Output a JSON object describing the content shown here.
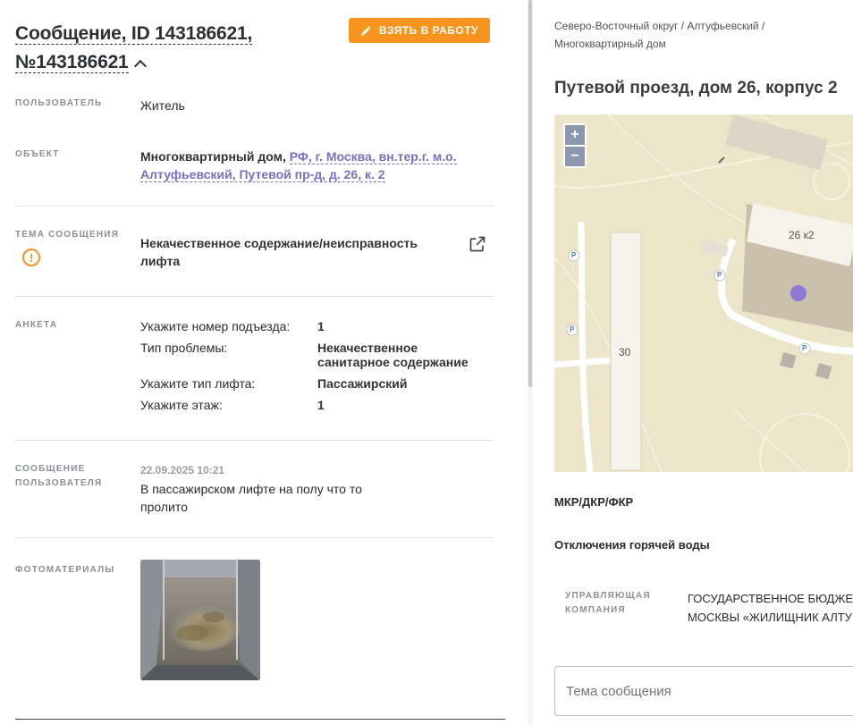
{
  "header": {
    "title_line1": "Сообщение, ID 143186621,",
    "title_line2": "№143186621",
    "take_button": "ВЗЯТЬ В РАБОТУ"
  },
  "user": {
    "label": "ПОЛЬЗОВАТЕЛЬ",
    "value": "Житель"
  },
  "object": {
    "label": "ОБЪЕКТ",
    "type": "Многоквартирный дом,",
    "address_link_line1": "РФ, г. Москва, вн.тер.г. м.о.",
    "address_link_line2": "Алтуфьевский, Путевой пр-д, д. 26, к. 2"
  },
  "topic": {
    "label": "ТЕМА СООБЩЕНИЯ",
    "value": "Некачественное содержание/неисправность лифта",
    "warn_glyph": "!"
  },
  "survey": {
    "label": "АНКЕТА",
    "rows": [
      {
        "q": "Укажите номер подъезда:",
        "a": "1"
      },
      {
        "q": "Тип проблемы:",
        "a": "Некачественное санитарное содержание"
      },
      {
        "q": "Укажите тип лифта:",
        "a": "Пассажирский"
      },
      {
        "q": "Укажите этаж:",
        "a": "1"
      }
    ]
  },
  "user_message": {
    "label_line1": "СООБЩЕНИЕ",
    "label_line2": "ПОЛЬЗОВАТЕЛЯ",
    "date": "22.09.2025 10:21",
    "text": "В пассажирском лифте на полу что то пролито"
  },
  "photos": {
    "label": "ФОТОМАТЕРИАЛЫ"
  },
  "right": {
    "breadcrumb": "Северо-Восточный округ / Алтуфьевский / Многоквартирный дом",
    "address": "Путевой проезд, дом 26, корпус 2",
    "map": {
      "zoom_in": "+",
      "zoom_out": "−",
      "building_main": "26 к2",
      "building_side": "30",
      "parking": "P"
    },
    "section1": "МКР/ДКР/ФКР",
    "section2": "Отключения горячей воды",
    "mc_label_line1": "УПРАВЛЯЮЩАЯ",
    "mc_label_line2": "КОМПАНИЯ",
    "mc_value_line1": "ГОСУДАРСТВЕННОЕ БЮДЖЕ",
    "mc_value_line2": "МОСКВЫ «ЖИЛИЩНИК АЛТУ",
    "topic_placeholder": "Тема сообщения"
  },
  "colors": {
    "accent": "#f7941d",
    "link": "#7a6fc4",
    "map_bg": "#ede5c9",
    "marker": "#8e79d6"
  }
}
